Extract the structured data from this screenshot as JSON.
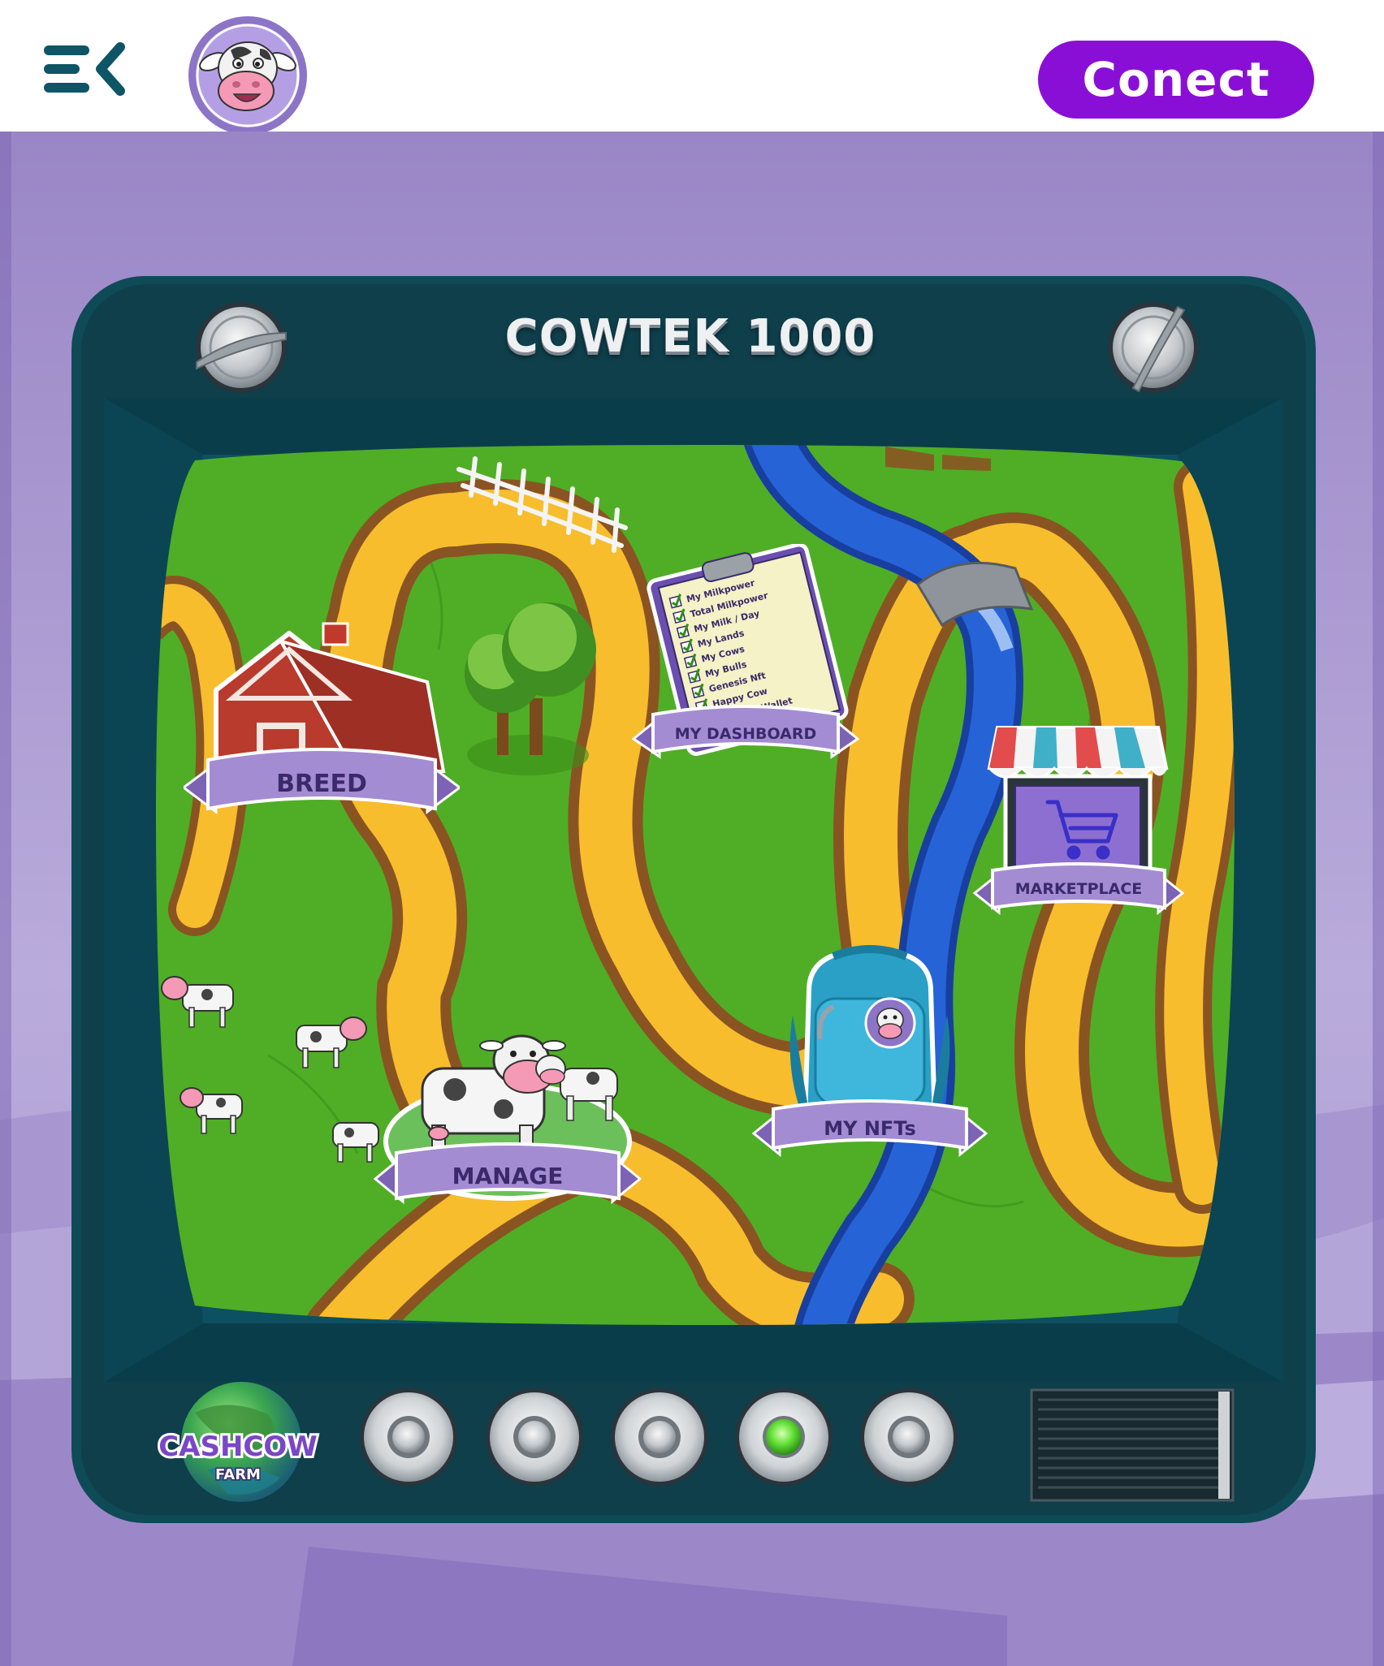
{
  "header": {
    "menu_icon": "menu-collapse-icon",
    "logo_icon": "cow-face-avatar-icon",
    "connect_label": "Conect"
  },
  "tv": {
    "title": "COWTEK 1000",
    "brand_line1": "CASHCOW",
    "brand_line2": "FARM",
    "active_light_index": 4
  },
  "map": {
    "breed_label": "BREED",
    "dashboard_label": "MY DASHBOARD",
    "marketplace_label": "MARKETPLACE",
    "nfts_label": "MY NFTs",
    "manage_label": "MANAGE",
    "checklist": [
      "My Milkpower",
      "Total Milkpower",
      "My Milk / Day",
      "My Lands",
      "My Cows",
      "My Bulls",
      "Genesis Nft",
      "Happy Cow",
      "$COW In Wallet"
    ]
  },
  "colors": {
    "accent": "#8a0fd6",
    "tv_body": "#0f4a57",
    "grass": "#4fae25",
    "path": "#f7bd2d",
    "river": "#1e55c8",
    "banner": "#a48cd3",
    "background": "#b7a8d9",
    "power_light": "#66e23a"
  }
}
